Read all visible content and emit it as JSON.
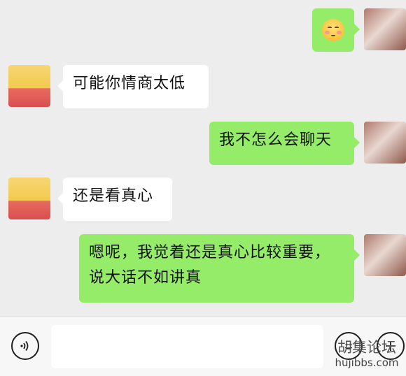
{
  "chat": {
    "messages": [
      {
        "side": "right",
        "type": "emoji",
        "emoji_name": "shy-smile-emoji",
        "avatar": "girl-avatar"
      },
      {
        "side": "left",
        "type": "text",
        "text": "可能你情商太低",
        "avatar": "pig-avatar"
      },
      {
        "side": "right",
        "type": "text",
        "text": "我不怎么会聊天",
        "avatar": "girl-avatar"
      },
      {
        "side": "left",
        "type": "text",
        "text": "还是看真心",
        "avatar": "pig-avatar"
      },
      {
        "side": "right",
        "type": "text",
        "line1": "嗯呢，我觉着还是真心比较重要，",
        "line2": "说大话不如讲真",
        "avatar": "girl-avatar"
      }
    ],
    "colors": {
      "self_bubble": "#95ec69",
      "other_bubble": "#ffffff",
      "background": "#ededed"
    }
  },
  "input_bar": {
    "voice_icon": "voice-icon",
    "emoji_icon": "emoji-icon",
    "plus_icon": "plus-icon",
    "input_value": ""
  },
  "watermark": {
    "cn": "胡集论坛",
    "en": "hujibbs.com"
  }
}
